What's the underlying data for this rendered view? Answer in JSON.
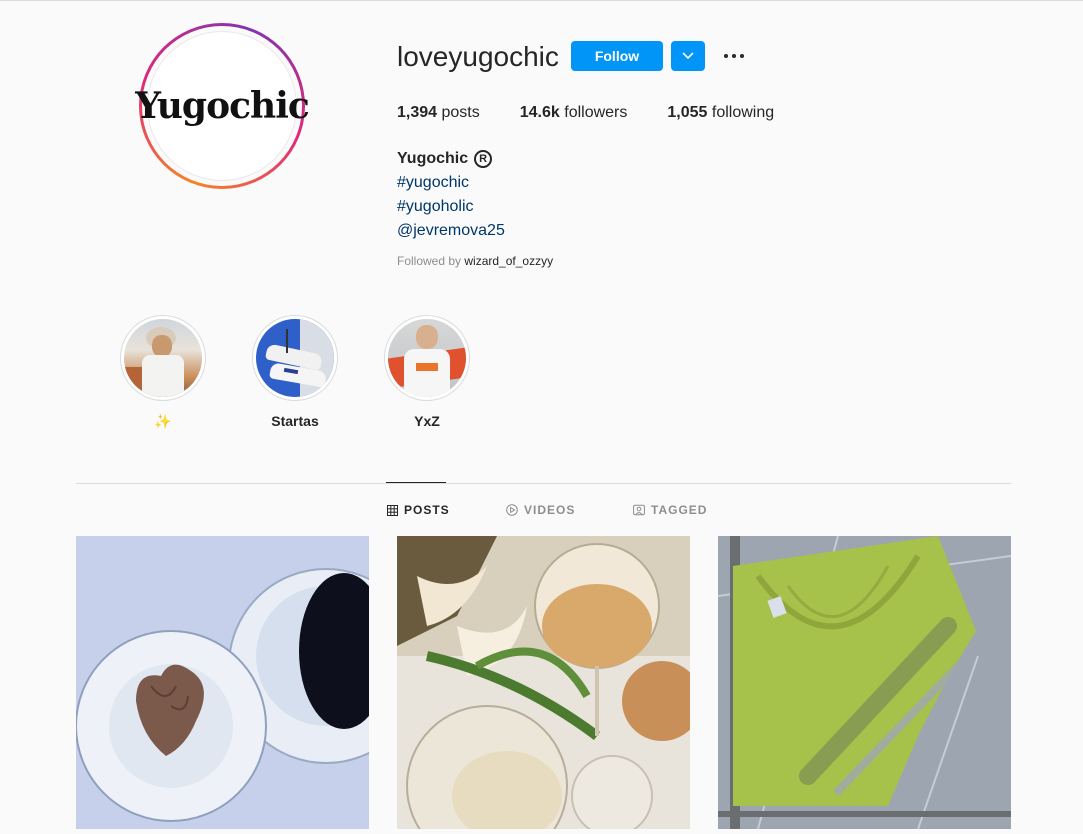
{
  "profile": {
    "username": "loveyugochic",
    "avatar_text": "Yugochic",
    "follow_label": "Follow",
    "stats": [
      {
        "value": "1,394",
        "label": "posts"
      },
      {
        "value": "14.6k",
        "label": "followers"
      },
      {
        "value": "1,055",
        "label": "following"
      }
    ],
    "bio_name": "Yugochic",
    "bio_name_badge": "R",
    "bio_lines": [
      "#yugochic",
      "#yugoholic",
      "@jevremova25"
    ],
    "followed_by_prefix": "Followed by",
    "followed_by_user": "wizard_of_ozzyy"
  },
  "highlights": [
    {
      "label": "✨"
    },
    {
      "label": "Startas"
    },
    {
      "label": "YxZ"
    }
  ],
  "tabs": [
    {
      "label": "POSTS",
      "icon": "grid-icon",
      "active": true
    },
    {
      "label": "VIDEOS",
      "icon": "play-icon",
      "active": false
    },
    {
      "label": "TAGGED",
      "icon": "tag-icon",
      "active": false
    }
  ],
  "posts": [
    {
      "subject": "chocolate-heart-coffee"
    },
    {
      "subject": "wine-glass-flowers"
    },
    {
      "subject": "green-yugochic-sweatshirt"
    }
  ],
  "colors": {
    "accent": "#0095f6",
    "link": "#00376b",
    "muted": "#8e8e8e",
    "text": "#262626"
  }
}
